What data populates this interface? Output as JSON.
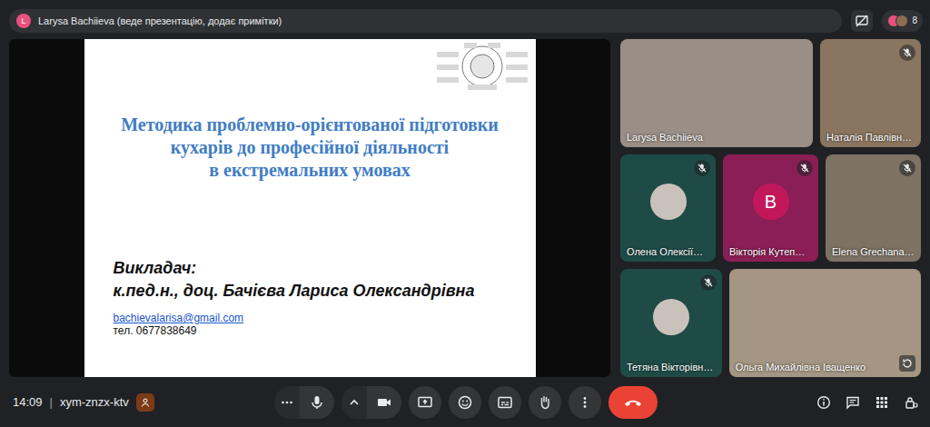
{
  "top_bar": {
    "avatar_letter": "L",
    "avatar_color": "#e8517d",
    "presenter_text": "Larysa Bachiieva (веде презентацію, додає примітки)",
    "participant_count": "8"
  },
  "slide": {
    "title_lines": [
      "Методика проблемно-орієнтованої підготовки",
      "кухарів до професійної діяльності",
      "в екстремальних умовах"
    ],
    "lecturer_label": "Викладач:",
    "lecturer_name": "к.пед.н., доц. Бачієва Лариса Олександрівна",
    "email": "bachievalarisa@gmail.com",
    "phone": "тел. 0677838649"
  },
  "tiles": [
    {
      "name": "Larysa Bachiieva",
      "kind": "video",
      "muted": false,
      "self": false,
      "color": "#9a8f86"
    },
    {
      "name": "Наталія Павлівн…",
      "kind": "video",
      "muted": true,
      "self": false,
      "color": "#8a7560"
    },
    {
      "name": "Олена Олексії…",
      "kind": "photo-avatar",
      "muted": true,
      "self": false,
      "color": "#1f4b47"
    },
    {
      "name": "Вікторія Кутеп…",
      "kind": "letter-avatar",
      "letter": "В",
      "muted": true,
      "self": false,
      "color": "#8b1f55"
    },
    {
      "name": "Elena Grechana…",
      "kind": "video",
      "muted": true,
      "self": false,
      "color": "#7d7264"
    },
    {
      "name": "Тетяна Вікторівн…",
      "kind": "photo-avatar",
      "muted": true,
      "self": false,
      "color": "#1f4b47"
    },
    {
      "name": "Ольга Михайлівна Іващенко",
      "kind": "video",
      "muted": false,
      "self": true,
      "color": "#a49682"
    }
  ],
  "bottom_bar": {
    "time": "14:09",
    "separator": "|",
    "meeting_code": "xym-znzx-ktv",
    "controls": [
      {
        "kind": "more"
      },
      {
        "kind": "mic",
        "on": true
      },
      {
        "kind": "caret"
      },
      {
        "kind": "camera",
        "on": true
      },
      {
        "kind": "present"
      },
      {
        "kind": "emoji"
      },
      {
        "kind": "captions"
      },
      {
        "kind": "hand"
      },
      {
        "kind": "options"
      },
      {
        "kind": "end-call"
      }
    ],
    "right_icons": [
      {
        "kind": "info"
      },
      {
        "kind": "chat"
      },
      {
        "kind": "activities"
      },
      {
        "kind": "host-controls"
      }
    ]
  }
}
